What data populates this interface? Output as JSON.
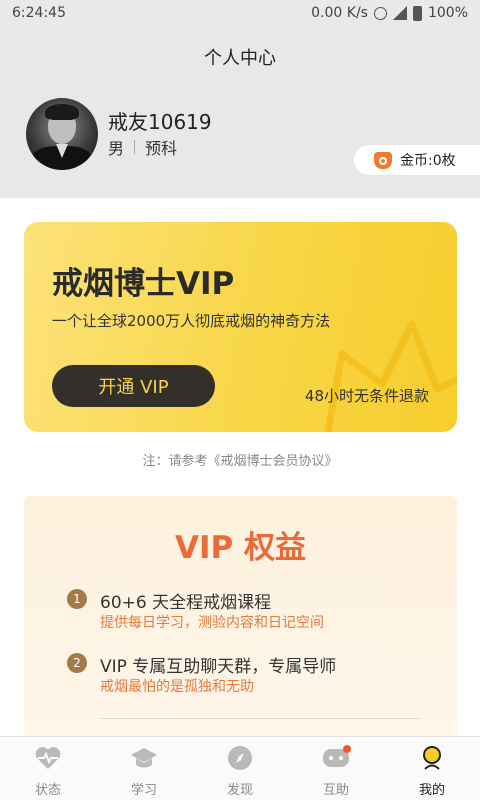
{
  "status_bar": {
    "time": "6:24:45",
    "network_speed": "0.00 K/s",
    "battery": "100%"
  },
  "header": {
    "title": "个人中心",
    "username": "戒友10619",
    "gender": "男",
    "stage": "预科",
    "coins": "金币:0枚"
  },
  "vip_card": {
    "title": "戒烟博士VIP",
    "subtitle": "一个让全球2000万人彻底戒烟的神奇方法",
    "button_label": "开通 VIP",
    "refund_note": "48小时无条件退款"
  },
  "agreement_note": "注：请参考《戒烟博士会员协议》",
  "benefits": {
    "title": "VIP 权益",
    "items": [
      {
        "num": "1",
        "heading": "60+6 天全程戒烟课程",
        "desc": "提供每日学习，测验内容和日记空间"
      },
      {
        "num": "2",
        "heading": "VIP 专属互助聊天群，专属导师",
        "desc": "戒烟最怕的是孤独和无助"
      }
    ]
  },
  "tabs": [
    {
      "label": "状态",
      "icon": "heart-pulse-icon"
    },
    {
      "label": "学习",
      "icon": "graduation-cap-icon"
    },
    {
      "label": "发现",
      "icon": "compass-icon"
    },
    {
      "label": "互助",
      "icon": "chat-bubble-icon"
    },
    {
      "label": "我的",
      "icon": "profile-icon"
    }
  ],
  "colors": {
    "vip_gold": "#f8d646",
    "accent_orange": "#ea6a3a",
    "button_dark": "#33302b",
    "notification_dot": "#f05a28"
  }
}
